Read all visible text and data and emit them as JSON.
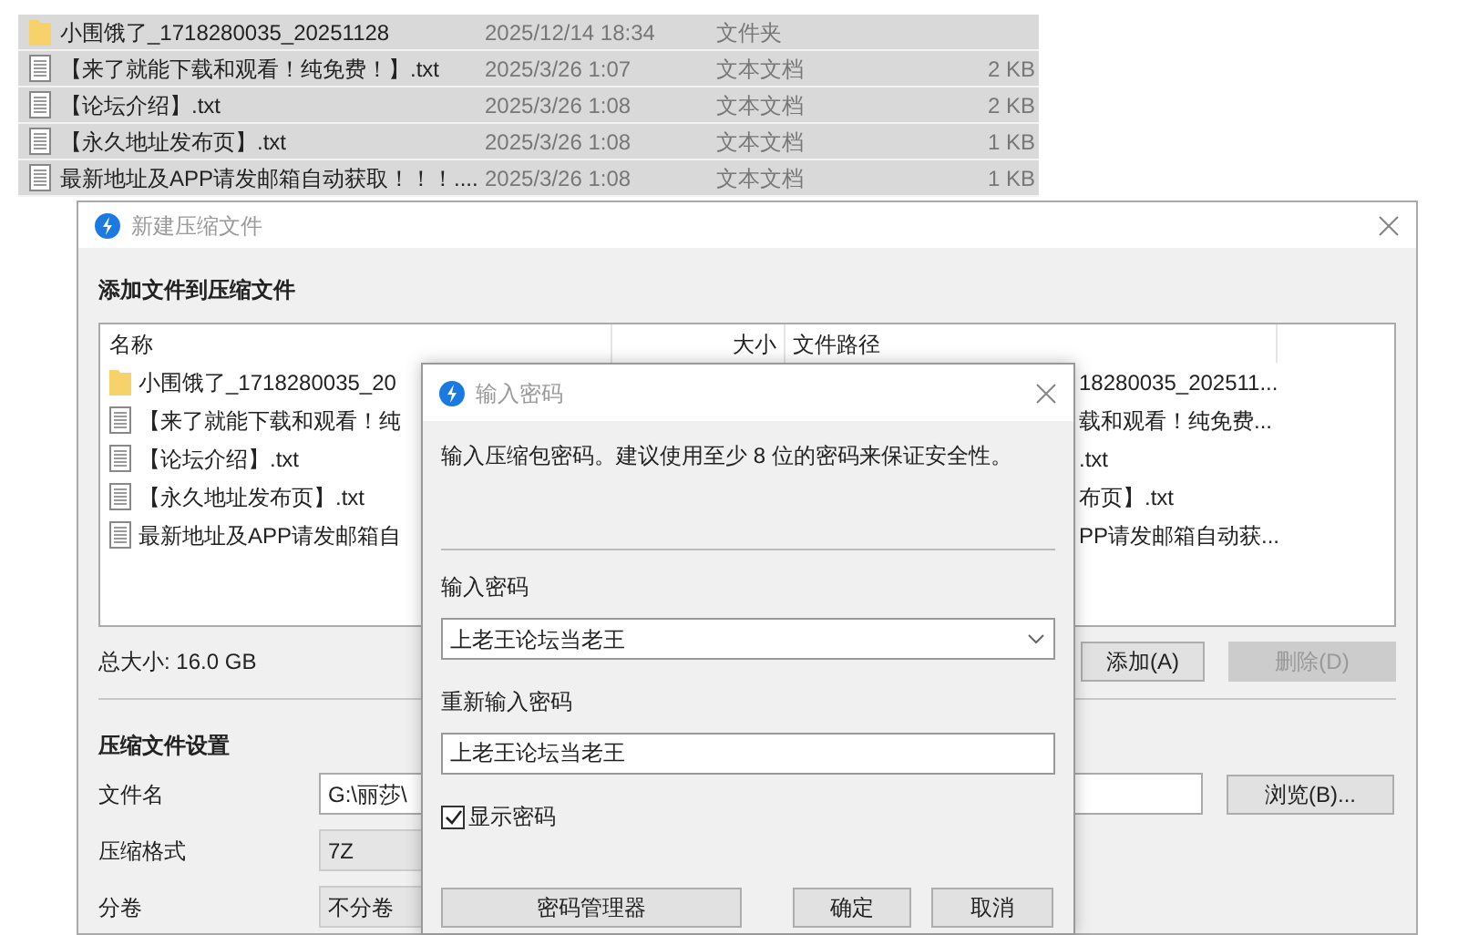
{
  "explorer": {
    "rows": [
      {
        "kind": "folder",
        "name": "小围饿了_1718280035_20251128",
        "date": "2025/12/14 18:34",
        "type": "文件夹",
        "selected": true
      },
      {
        "kind": "file",
        "name": "【来了就能下载和观看！纯免费！】.txt",
        "date": "2025/3/26 1:07",
        "type": "文本文档",
        "size": "2 KB",
        "selected": true
      },
      {
        "kind": "file",
        "name": "【论坛介绍】.txt",
        "date": "2025/3/26 1:08",
        "type": "文本文档",
        "size": "2 KB",
        "selected": true
      },
      {
        "kind": "file",
        "name": "【永久地址发布页】.txt",
        "date": "2025/3/26 1:08",
        "type": "文本文档",
        "size": "1 KB",
        "selected": true
      },
      {
        "kind": "file",
        "name": "最新地址及APP请发邮箱自动获取！！！....",
        "date": "2025/3/26 1:08",
        "type": "文本文档",
        "size": "1 KB",
        "selected": true
      }
    ]
  },
  "main_window": {
    "title": "新建压缩文件",
    "heading": "添加文件到压缩文件",
    "list": {
      "columns": [
        "名称",
        "大小",
        "文件路径"
      ],
      "rows": [
        {
          "kind": "folder",
          "name": "小围饿了_1718280035_20",
          "path": "18280035_202511..."
        },
        {
          "kind": "file",
          "name": "【来了就能下载和观看！纯",
          "path": "载和观看！纯免费..."
        },
        {
          "kind": "file",
          "name": "【论坛介绍】.txt",
          "path": ".txt"
        },
        {
          "kind": "file",
          "name": "【永久地址发布页】.txt",
          "path": "布页】.txt"
        },
        {
          "kind": "file",
          "name": "最新地址及APP请发邮箱自",
          "path": "PP请发邮箱自动获..."
        }
      ]
    },
    "total_size": "总大小: 16.0 GB",
    "buttons": [
      {
        "label": "添加(A)",
        "disabled": false
      },
      {
        "label": "删除(D)",
        "disabled": true
      }
    ],
    "settings_heading": "压缩文件设置",
    "settings": [
      {
        "kind": "input",
        "label": "文件名",
        "value": "G:\\丽莎\\"
      },
      {
        "kind": "select",
        "label": "压缩格式",
        "value": "7Z"
      },
      {
        "kind": "select",
        "label": "分卷",
        "value": "不分卷"
      }
    ],
    "browse_button": "浏览(B)..."
  },
  "password_dialog": {
    "title": "输入密码",
    "description": "输入压缩包密码。建议使用至少 8 位的密码来保证安全性。",
    "password_label": "输入密码",
    "password": "上老王论坛当老王",
    "confirm_label": "重新输入密码",
    "confirm": "上老王论坛当老王",
    "show_password": {
      "label": "显示密码",
      "checked": true
    },
    "buttons": [
      "密码管理器",
      "确定",
      "取消"
    ]
  }
}
